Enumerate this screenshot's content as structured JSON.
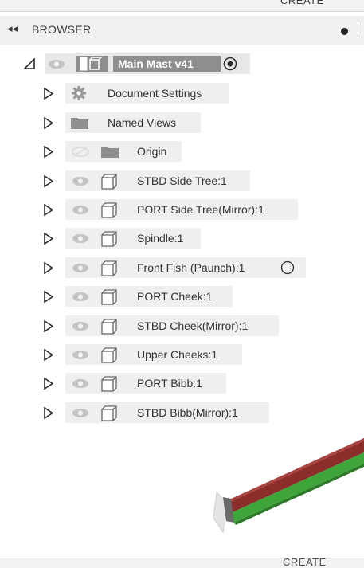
{
  "toolbar": {
    "create_label": "CREATE"
  },
  "browser": {
    "collapse_icon": "double-chevron-left-icon",
    "title": "BROWSER",
    "root": {
      "label": "Main Mast v41"
    },
    "items": [
      {
        "label": "Document Settings",
        "icon": "gear-icon"
      },
      {
        "label": "Named Views",
        "icon": "folder-icon"
      },
      {
        "label": "Origin",
        "icon": "folder-icon"
      },
      {
        "label": "STBD Side Tree:1",
        "icon": "component-icon"
      },
      {
        "label": "PORT Side Tree(Mirror):1",
        "icon": "component-icon"
      },
      {
        "label": "Spindle:1",
        "icon": "component-icon"
      },
      {
        "label": "Front Fish (Paunch):1",
        "icon": "component-icon"
      },
      {
        "label": "PORT  Cheek:1",
        "icon": "component-icon"
      },
      {
        "label": "STBD  Cheek(Mirror):1",
        "icon": "component-icon"
      },
      {
        "label": "Upper Cheeks:1",
        "icon": "component-icon"
      },
      {
        "label": "PORT  Bibb:1",
        "icon": "component-icon"
      },
      {
        "label": "STBD  Bibb(Mirror):1",
        "icon": "component-icon"
      }
    ]
  },
  "colors": {
    "mast_red": "#8b2d2b",
    "mast_green": "#3fa53a",
    "header_bg": "#f0f0f0",
    "chip_bg": "#efefef"
  }
}
